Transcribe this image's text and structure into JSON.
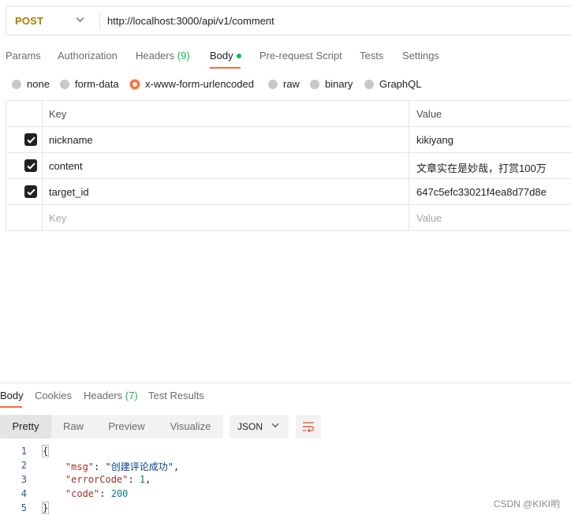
{
  "request": {
    "method": "POST",
    "url": "http://localhost:3000/api/v1/comment"
  },
  "request_tabs": [
    {
      "label": "Params"
    },
    {
      "label": "Authorization"
    },
    {
      "label": "Headers",
      "count": "(9)"
    },
    {
      "label": "Body"
    },
    {
      "label": "Pre-request Script"
    },
    {
      "label": "Tests"
    },
    {
      "label": "Settings"
    }
  ],
  "body_types": [
    {
      "label": "none"
    },
    {
      "label": "form-data"
    },
    {
      "label": "x-www-form-urlencoded",
      "selected": true
    },
    {
      "label": "raw"
    },
    {
      "label": "binary"
    },
    {
      "label": "GraphQL"
    }
  ],
  "params_table": {
    "headers": {
      "key": "Key",
      "value": "Value"
    },
    "rows": [
      {
        "key": "nickname",
        "value": "kikiyang",
        "checked": true
      },
      {
        "key": "content",
        "value": "文章实在是妙哉，打赏100万",
        "checked": true
      },
      {
        "key": "target_id",
        "value": "647c5efc33021f4ea8d77d8e",
        "checked": true
      }
    ],
    "placeholder": {
      "key": "Key",
      "value": "Value"
    }
  },
  "response_tabs": [
    {
      "label": "Body"
    },
    {
      "label": "Cookies"
    },
    {
      "label": "Headers",
      "count": "(7)"
    },
    {
      "label": "Test Results"
    }
  ],
  "view_modes": [
    {
      "label": "Pretty"
    },
    {
      "label": "Raw"
    },
    {
      "label": "Preview"
    },
    {
      "label": "Visualize"
    }
  ],
  "format": "JSON",
  "response_code": {
    "line_numbers": [
      "1",
      "2",
      "3",
      "4",
      "5"
    ],
    "open_brace": "{",
    "close_brace": "}",
    "msg_key": "\"msg\"",
    "msg_value": "\"创建评论成功\"",
    "error_key": "\"errorCode\"",
    "error_value": "1",
    "code_key": "\"code\"",
    "code_value": "200"
  },
  "watermark": "CSDN @KIKI哟",
  "colors": {
    "accent": "#ff6c37",
    "method": "#ad7a03",
    "count_green": "#0cbb52"
  }
}
